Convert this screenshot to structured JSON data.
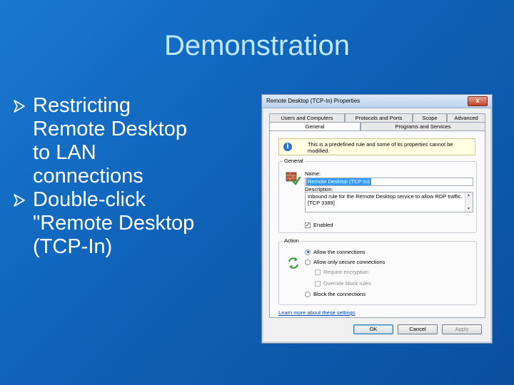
{
  "slide": {
    "title": "Demonstration",
    "bullets": [
      {
        "line1": "Restricting",
        "rest": [
          "Remote Desktop",
          "to LAN",
          "connections"
        ]
      },
      {
        "line1": "Double-click",
        "rest": [
          "\"Remote Desktop",
          "(TCP-In)"
        ]
      }
    ],
    "colors": {
      "background": "#1a6fc6",
      "title": "#bfe8ff",
      "text": "#ffffff"
    }
  },
  "dialog": {
    "title": "Remote Desktop (TCP-In) Properties",
    "close_label": "x",
    "tabs_row1": [
      "Users and Computers",
      "Protocols and Ports",
      "Scope",
      "Advanced"
    ],
    "tabs_row2": [
      "General",
      "Programs and Services"
    ],
    "active_tab": "General",
    "info_text": "This is a predefined rule and some of its properties cannot be modified.",
    "general_group": {
      "title": "General",
      "name_label": "Name:",
      "name_value": "Remote Desktop (TCP-In)",
      "description_label": "Description:",
      "description_value": "Inbound rule for the Remote Desktop service to allow RDP traffic. [TCP 3389]",
      "enabled_label": "Enabled",
      "enabled": true
    },
    "action_group": {
      "title": "Action",
      "allow_label": "Allow the connections",
      "allow_secure_label": "Allow only secure connections",
      "require_encryption_label": "Require encryption",
      "override_label": "Override block rules",
      "block_label": "Block the connections",
      "selected": "allow"
    },
    "learn_more": "Learn more about these settings",
    "buttons": {
      "ok": "OK",
      "cancel": "Cancel",
      "apply": "Apply"
    }
  },
  "icons": {
    "bullet": "arrow-bullet-icon",
    "info": "info-icon",
    "rule": "firewall-rule-icon",
    "action": "recycle-arrows-icon"
  }
}
